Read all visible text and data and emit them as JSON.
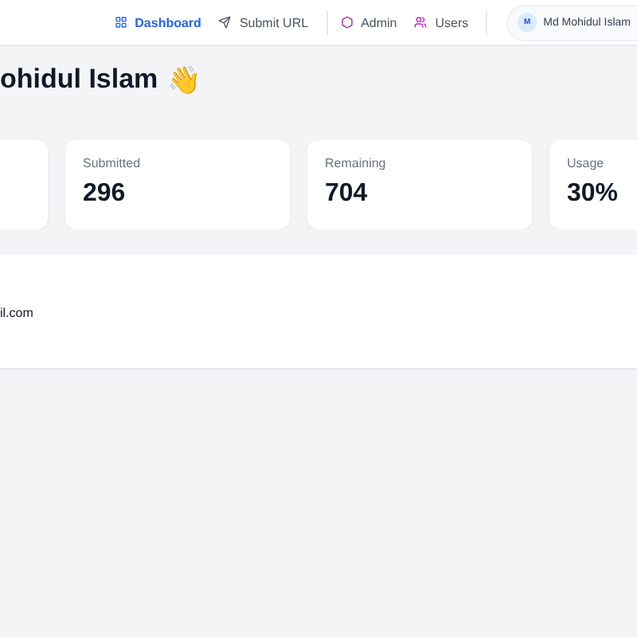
{
  "nav": {
    "items": [
      {
        "label": "Dashboard",
        "selected": true
      },
      {
        "label": "Submit URL",
        "selected": false
      },
      {
        "label": "Admin",
        "selected": false
      },
      {
        "label": "Users",
        "selected": false
      }
    ],
    "user": {
      "initial": "M",
      "name": "Md Mohidul Islam"
    }
  },
  "greeting": {
    "text": "ohidul Islam",
    "emoji": "👋"
  },
  "stats": [
    {
      "label": "Submitted",
      "value": "296"
    },
    {
      "label": "Remaining",
      "value": "704"
    },
    {
      "label": "Usage",
      "value": "30%"
    }
  ],
  "profile": {
    "email": "il.com"
  }
}
